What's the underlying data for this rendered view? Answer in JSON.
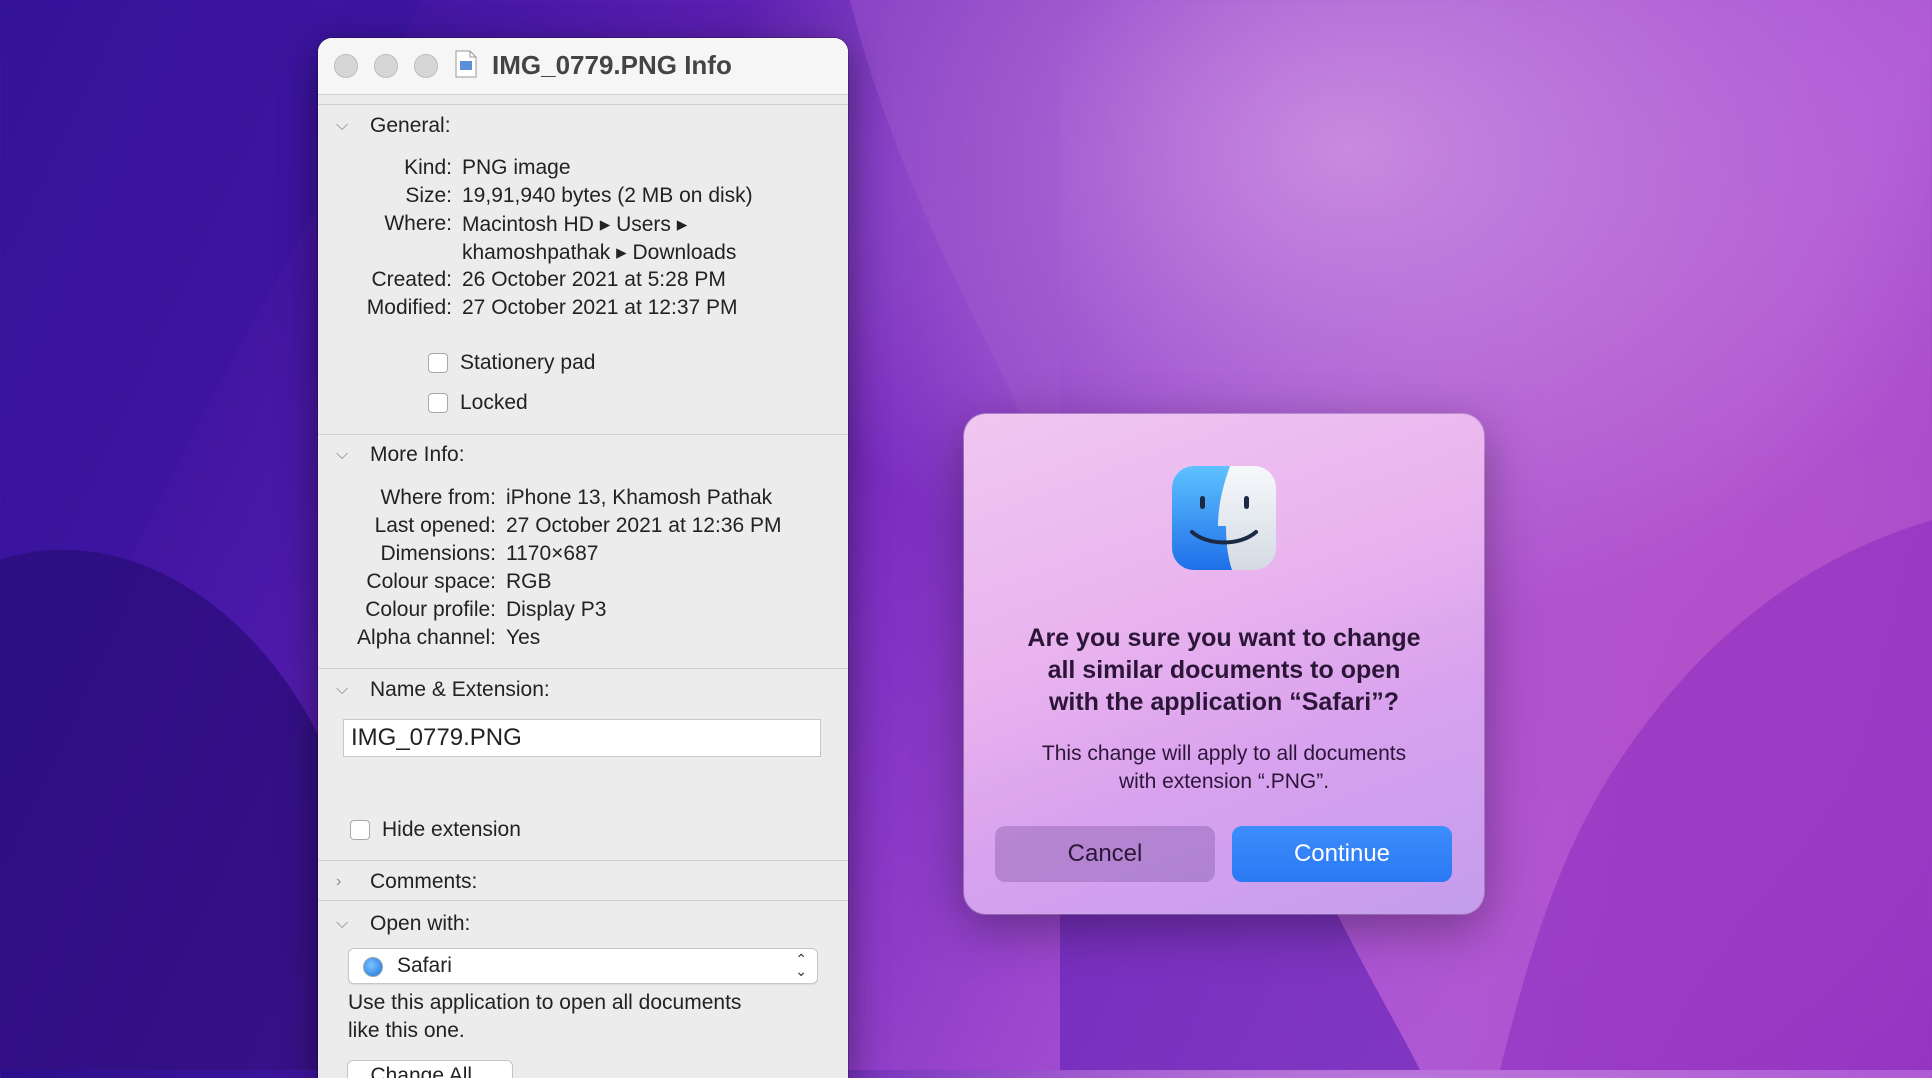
{
  "info_window": {
    "title": "IMG_0779.PNG Info",
    "general": {
      "header": "General:",
      "rows": [
        {
          "label": "Kind:",
          "value": "PNG image"
        },
        {
          "label": "Size:",
          "value": "19,91,940 bytes (2 MB on disk)"
        },
        {
          "label": "Where:",
          "value": "Macintosh HD ▸ Users ▸"
        },
        {
          "label": "",
          "value": "khamoshpathak ▸ Downloads"
        },
        {
          "label": "Created:",
          "value": "26 October 2021 at 5:28 PM"
        },
        {
          "label": "Modified:",
          "value": "27 October 2021 at 12:37 PM"
        }
      ],
      "stationery_label": "Stationery pad",
      "stationery_checked": false,
      "locked_label": "Locked",
      "locked_checked": false
    },
    "more_info": {
      "header": "More Info:",
      "rows": [
        {
          "label": "Where from:",
          "value": "iPhone 13, Khamosh Pathak"
        },
        {
          "label": "Last opened:",
          "value": "27 October 2021 at 12:36 PM"
        },
        {
          "label": "Dimensions:",
          "value": "1170×687"
        },
        {
          "label": "Colour space:",
          "value": "RGB"
        },
        {
          "label": "Colour profile:",
          "value": "Display P3"
        },
        {
          "label": "Alpha channel:",
          "value": "Yes"
        }
      ]
    },
    "name_extension": {
      "header": "Name & Extension:",
      "filename": "IMG_0779.PNG",
      "hide_extension_label": "Hide extension",
      "hide_extension_checked": false
    },
    "comments": {
      "header": "Comments:"
    },
    "open_with": {
      "header": "Open with:",
      "app": "Safari",
      "app_icon": "safari-icon",
      "description_line1": "Use this application to open all documents",
      "description_line2": "like this one.",
      "change_all_label": "Change All..."
    }
  },
  "dialog": {
    "icon": "finder-icon",
    "title_line1": "Are you sure you want to change",
    "title_line2": "all similar documents to open",
    "title_line3": "with the application “Safari”?",
    "message_line1": "This change will apply to all documents",
    "message_line2": "with extension “.PNG”.",
    "cancel_label": "Cancel",
    "continue_label": "Continue",
    "accent_color": "#2f7ff6"
  }
}
